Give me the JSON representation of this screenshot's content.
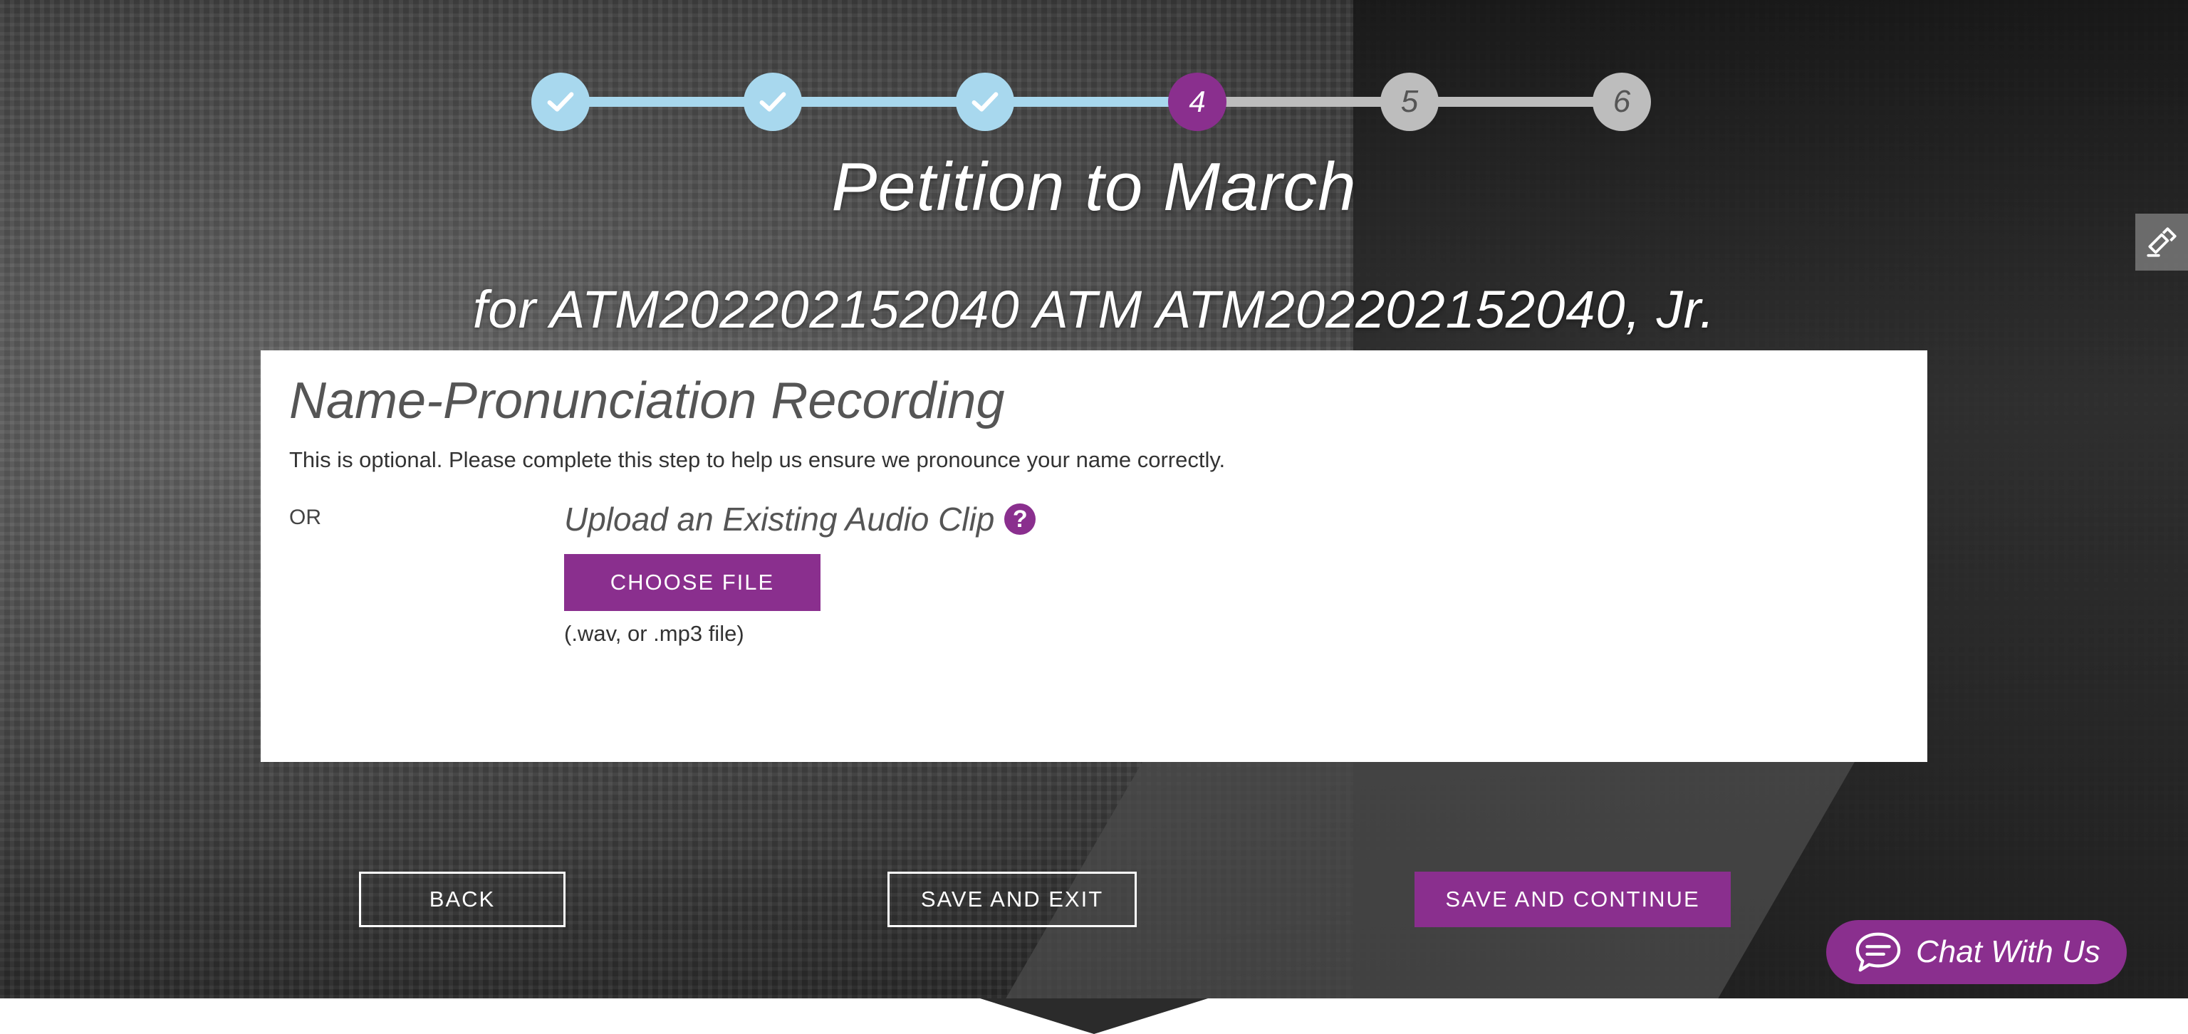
{
  "colors": {
    "accent": "#8a2f8e",
    "step_done": "#a8d8ee",
    "step_todo": "#bdbdbd"
  },
  "stepper": {
    "current_step": 4,
    "steps": [
      {
        "label": "",
        "state": "done",
        "icon": "check-icon"
      },
      {
        "label": "",
        "state": "done",
        "icon": "check-icon"
      },
      {
        "label": "",
        "state": "done",
        "icon": "check-icon"
      },
      {
        "label": "4",
        "state": "current"
      },
      {
        "label": "5",
        "state": "todo"
      },
      {
        "label": "6",
        "state": "todo"
      }
    ]
  },
  "header": {
    "title": "Petition to March",
    "subtitle": "for ATM202202152040 ATM ATM202202152040, Jr."
  },
  "card": {
    "heading": "Name-Pronunciation Recording",
    "intro": "This is optional. Please complete this step to help us ensure we pronounce your name correctly.",
    "or_label": "OR",
    "upload_title": "Upload an Existing Audio Clip",
    "help_icon": "question-icon",
    "choose_file_label": "CHOOSE FILE",
    "file_hint": "(.wav, or .mp3 file)"
  },
  "nav": {
    "back_label": "BACK",
    "save_exit_label": "SAVE AND EXIT",
    "save_continue_label": "SAVE AND CONTINUE"
  },
  "chat": {
    "label": "Chat With Us",
    "icon": "chat-bubble-icon"
  },
  "side_tab": {
    "icon": "feedback-icon"
  }
}
